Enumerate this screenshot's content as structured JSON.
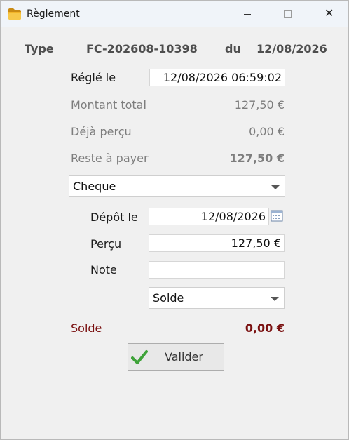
{
  "window": {
    "title": "Règlement",
    "icons": {
      "app": "folder-icon",
      "minimize": "minimize-icon",
      "maximize": "maximize-icon",
      "close": "close-icon"
    },
    "close_glyph": "✕"
  },
  "header": {
    "type_label": "Type",
    "doc_number": "FC-202608-10398",
    "du_label": "du",
    "doc_date": "12/08/2026"
  },
  "payment": {
    "regle_le_label": "Réglé le",
    "regle_le_value": "12/08/2026 06:59:02",
    "montant_total_label": "Montant total",
    "montant_total_value": "127,50 €",
    "deja_percu_label": "Déjà perçu",
    "deja_percu_value": "0,00 €",
    "reste_label": "Reste à payer",
    "reste_value": "127,50 €",
    "method_selected": "Cheque"
  },
  "cheque": {
    "depot_label": "Dépôt le",
    "depot_value": "12/08/2026",
    "percu_label": "Perçu",
    "percu_value": "127,50 €",
    "note_label": "Note",
    "note_value": "",
    "status_selected": "Solde"
  },
  "summary": {
    "solde_label": "Solde",
    "solde_value": "0,00 €"
  },
  "actions": {
    "valider_label": "Valider",
    "valider_icon": "checkmark-icon"
  },
  "colors": {
    "accent_red": "#7a1010",
    "check_green": "#3fa33a"
  }
}
